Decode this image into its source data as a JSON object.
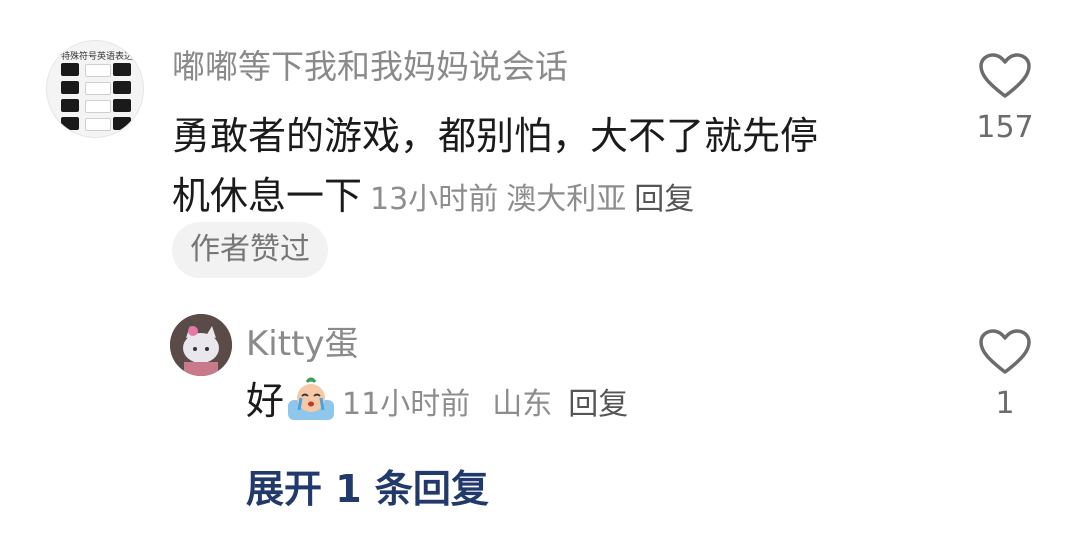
{
  "comment": {
    "username": "嘟嘟等下我和我妈妈说会话",
    "avatar_caption": "特殊符号英语表达",
    "text_line1": "勇敢者的游戏，都别怕，大不了就先停",
    "text_line2": "机休息一下",
    "time": "13小时前",
    "location": "澳大利亚",
    "reply_label": "回复",
    "author_liked_badge": "作者赞过",
    "like_count": "157",
    "like_icon": "heart-outline-icon"
  },
  "reply": {
    "username": "Kitty蛋",
    "text": "好",
    "emoji": "crying-emoji",
    "time": "11小时前",
    "location": "山东",
    "reply_label": "回复",
    "like_count": "1",
    "like_icon": "heart-outline-icon"
  },
  "expand_label": "展开 1 条回复",
  "colors": {
    "text_primary": "#1b1b1b",
    "text_secondary": "#8a8a8a",
    "expand_link": "#223a6b",
    "badge_bg": "#f2f2f2"
  }
}
